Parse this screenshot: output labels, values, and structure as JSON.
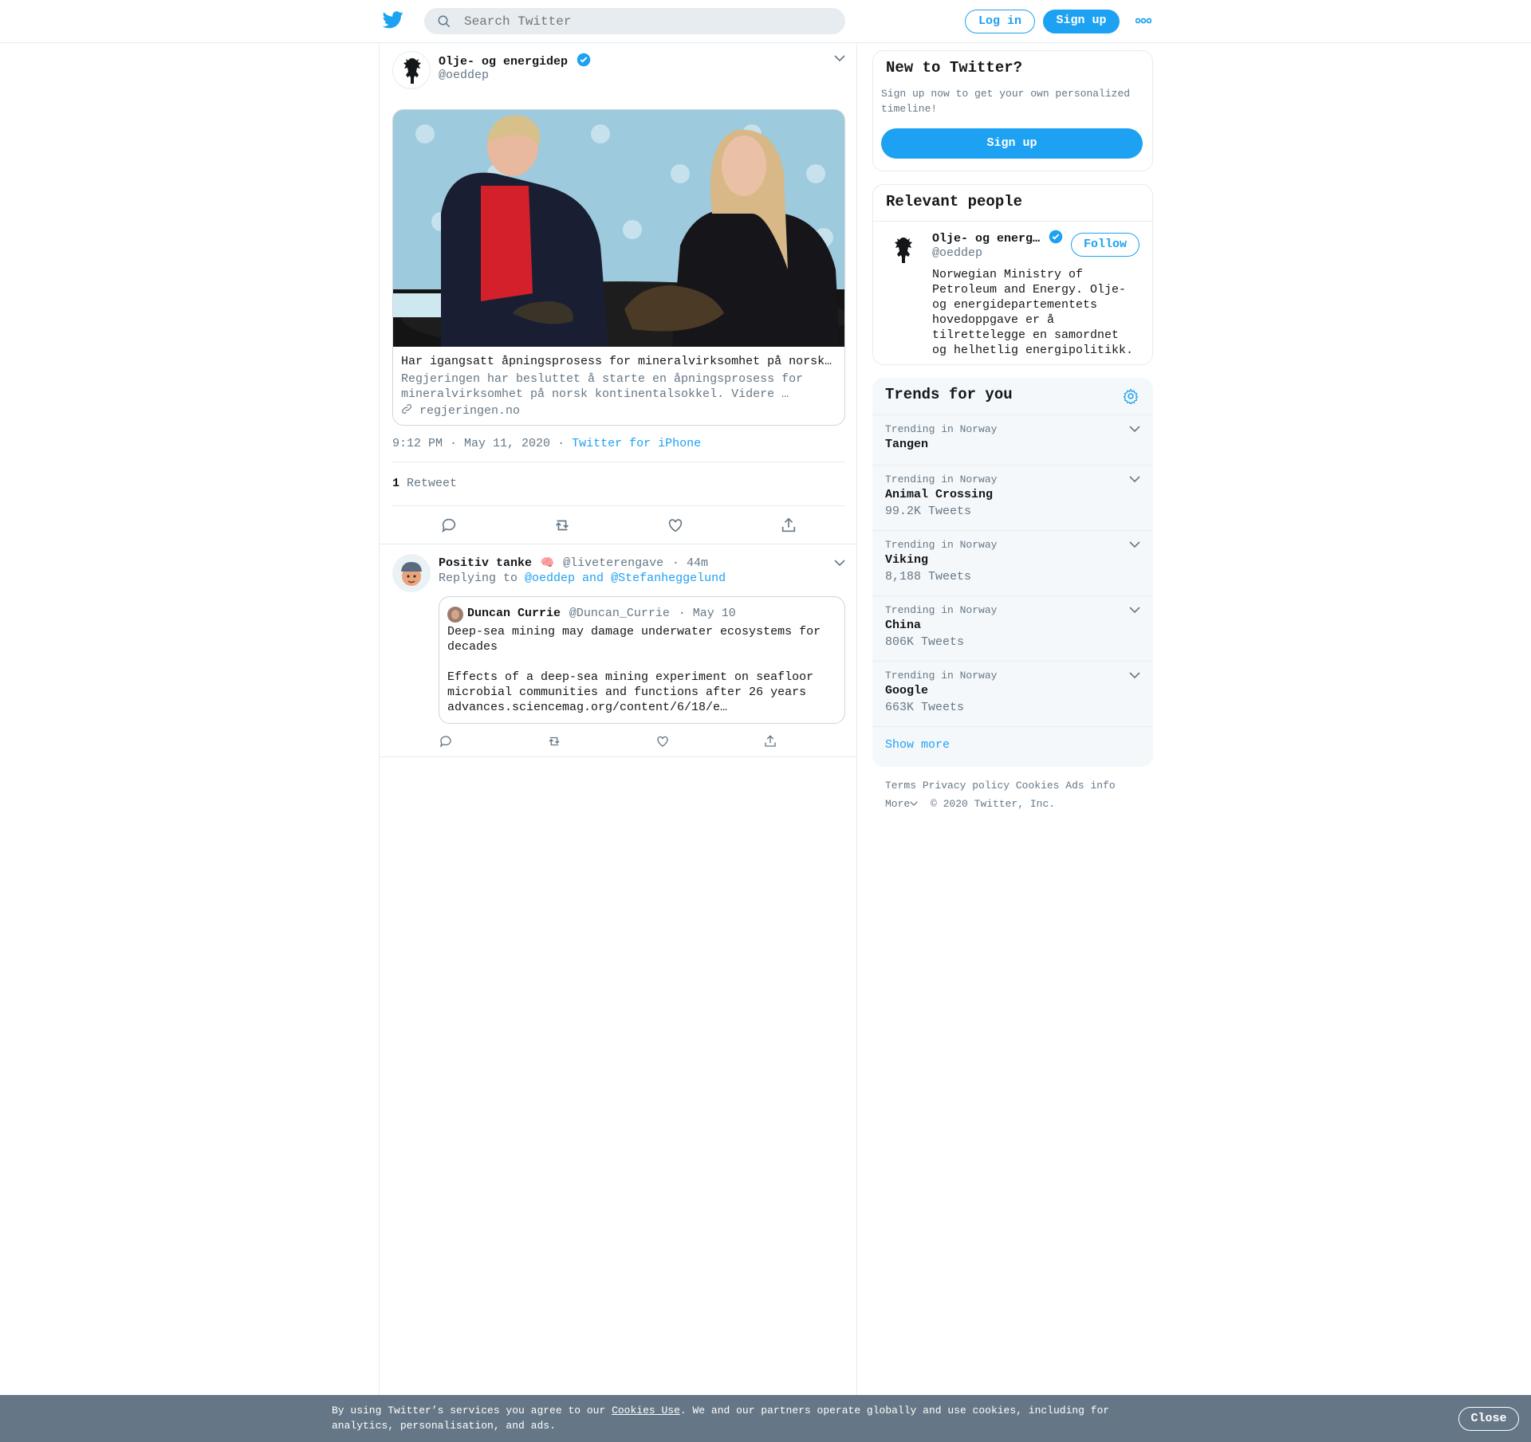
{
  "search": {
    "placeholder": "Search Twitter"
  },
  "header": {
    "login": "Log in",
    "signup": "Sign up",
    "more_icon": "more-dots-icon"
  },
  "tweet": {
    "author_name": "Olje- og energidep",
    "author_handle": "@oeddep",
    "card": {
      "title": "Har igangsatt åpningsprosess for mineralvirksomhet på norsk…",
      "desc_line1": "Regjeringen har besluttet å starte en åpningsprosess for",
      "desc_line2": "mineralvirksomhet på norsk kontinentalsokkel. Videre …",
      "domain": "regjeringen.no"
    },
    "time": "9:12 PM · May 11, 2020",
    "sep": "·",
    "source": "Twitter for iPhone",
    "retweet_count": "1",
    "retweet_label": "Retweet"
  },
  "reply": {
    "author_name": "Positiv tanke",
    "emoji": "🧠",
    "author_handle": "@liveterengave",
    "time": "· 44m",
    "replying_to_label": "Replying to",
    "replying_to_users": "@oeddep and @Stefanheggelund",
    "quote": {
      "name": "Duncan Currie",
      "handle": "@Duncan_Currie",
      "date": "· May 10",
      "line1": "Deep-sea mining may damage underwater ecosystems for",
      "line2": "decades",
      "line3": "Effects of a deep-sea mining experiment on seafloor",
      "line4": "microbial communities and functions after 26 years",
      "line5": "advances.sciencemag.org/content/6/18/e…"
    }
  },
  "sidebar": {
    "new_title": "New to Twitter?",
    "new_desc_line1": "Sign up now to get your own personalized",
    "new_desc_line2": "timeline!",
    "signup": "Sign up",
    "relevant_title": "Relevant people",
    "person": {
      "name": "Olje- og energ…",
      "handle": "@oeddep",
      "follow": "Follow",
      "bio": [
        "Norwegian Ministry of",
        "Petroleum and Energy. Olje-",
        "og energidepartementets",
        "hovedoppgave er å",
        "tilrettelegge en samordnet",
        "og helhetlig energipolitikk."
      ]
    },
    "trends_title": "Trends for you",
    "trends": [
      {
        "context": "Trending in Norway",
        "name": "Tangen",
        "count": ""
      },
      {
        "context": "Trending in Norway",
        "name": "Animal Crossing",
        "count": "99.2K Tweets"
      },
      {
        "context": "Trending in Norway",
        "name": "Viking",
        "count": "8,188 Tweets"
      },
      {
        "context": "Trending in Norway",
        "name": "China",
        "count": "806K Tweets"
      },
      {
        "context": "Trending in Norway",
        "name": "Google",
        "count": "663K Tweets"
      }
    ],
    "show_more": "Show more",
    "footer": {
      "terms": "Terms",
      "privacy": "Privacy policy",
      "cookies": "Cookies",
      "ads": "Ads info",
      "more": "More",
      "copyright": "© 2020 Twitter, Inc."
    }
  },
  "cookie_bar": {
    "text_before": "By using Twitter’s services you agree to our ",
    "link": "Cookies Use",
    "text_after1": ". We and our partners operate globally and use cookies, including for",
    "text_after2": "analytics, personalisation, and ads.",
    "close": "Close"
  },
  "colors": {
    "accent": "#1da1f2",
    "text": "#14171a",
    "muted": "#657786",
    "border": "#e6ecf0",
    "cookie_bg": "#657786"
  }
}
